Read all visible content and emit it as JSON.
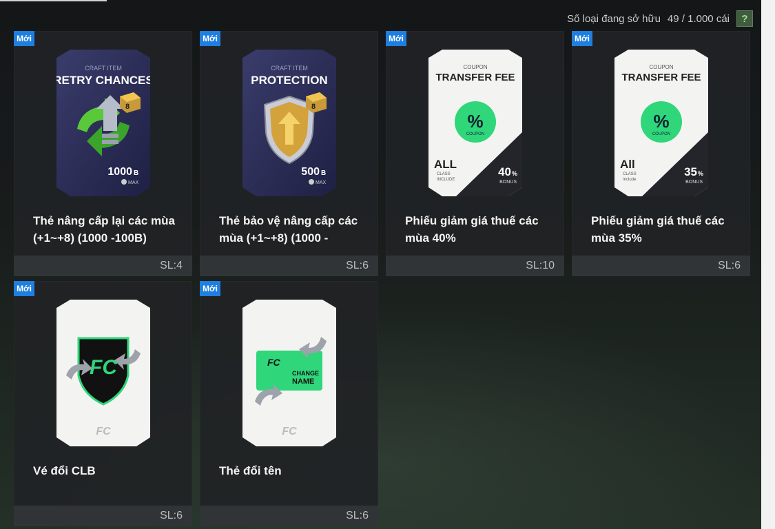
{
  "header": {
    "owned_label": "Số loại đang sở hữu",
    "owned_count": "49 / 1.000 cái",
    "help_label": "?"
  },
  "colors": {
    "badge": "#1f7fe0",
    "coupon_green": "#2fd67a",
    "dark_card": "#2b2d55"
  },
  "items": [
    {
      "badge": "Mới",
      "card_top": "CRAFT ITEM",
      "card_title": "RETRY CHANCES",
      "level": "8",
      "value": "1000",
      "unit": "B",
      "max": "MAX",
      "name": "Thẻ nâng cấp lại các mùa (+1~+8) (1000 -100B)",
      "qty": "SL:4"
    },
    {
      "badge": "Mới",
      "card_top": "CRAFT ITEM",
      "card_title": "PROTECTION",
      "level": "8",
      "value": "500",
      "unit": "B",
      "max": "MAX",
      "name": "Thẻ bảo vệ nâng cấp các mùa (+1~+8) (1000 -",
      "qty": "SL:6"
    },
    {
      "badge": "Mới",
      "card_top": "COUPON",
      "card_title": "TRANSFER FEE",
      "coupon_label": "COUPON",
      "class": "ALL",
      "class_sub1": "CLASS",
      "class_sub2": "INCLUDE",
      "percent": "40",
      "bonus": "BONUS",
      "name": "Phiếu giảm giá thuế các mùa 40%",
      "qty": "SL:10"
    },
    {
      "badge": "Mới",
      "card_top": "COUPON",
      "card_title": "TRANSFER FEE",
      "coupon_label": "COUPON",
      "class": "All",
      "class_sub1": "CLASS",
      "class_sub2": "Include",
      "percent": "35",
      "bonus": "BONUS",
      "name": "Phiếu giảm giá thuế các mùa 35%",
      "qty": "SL:6"
    },
    {
      "badge": "Mới",
      "name": "Vé đổi CLB",
      "qty": "SL:6"
    },
    {
      "badge": "Mới",
      "change_line1": "CHANGE",
      "change_line2": "NAME",
      "name": "Thẻ đổi tên",
      "qty": "SL:6"
    }
  ]
}
